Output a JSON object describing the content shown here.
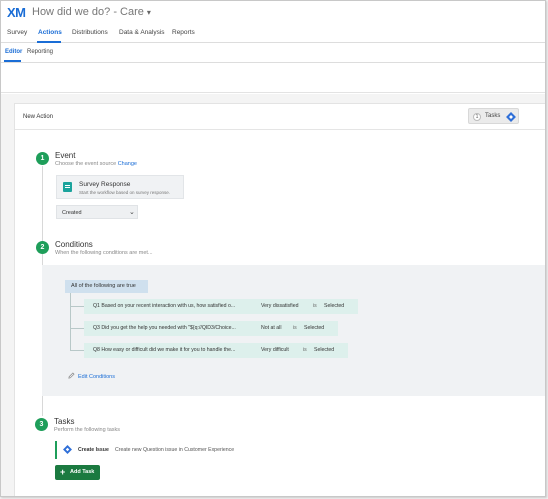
{
  "app": {
    "logo": "XM",
    "project_title": "How did we do? - Care"
  },
  "nav": {
    "tabs": [
      "Survey",
      "Actions",
      "Distributions",
      "Data & Analysis",
      "Reports"
    ],
    "active": "Actions"
  },
  "subnav": {
    "tabs": [
      "Editor",
      "Reporting"
    ],
    "active": "Editor"
  },
  "action": {
    "title": "New Action",
    "tasks_count": "1",
    "tasks_label": "Tasks"
  },
  "event": {
    "number": "1",
    "title": "Event",
    "subtitle": "Choose the event source",
    "change_link": "Change",
    "source_title": "Survey Response",
    "source_desc": "Start the workflow based on survey response.",
    "select_value": "Created"
  },
  "conditions": {
    "number": "2",
    "title": "Conditions",
    "subtitle": "When the following conditions are met...",
    "group_label": "All of the following are true",
    "rows": [
      {
        "question": "Q1 Based on your recent interaction with us, how satisfied o...",
        "value": "Very dissatisfied",
        "op": "is",
        "state": "Selected"
      },
      {
        "question": "Q3 Did you get the help you needed with \"${q://QID3/Choice...",
        "value": "Not at all",
        "op": "is",
        "state": "Selected"
      },
      {
        "question": "Q8 How easy or difficult did we make it for you to handle the...",
        "value": "Very difficult",
        "op": "is",
        "state": "Selected"
      }
    ],
    "edit_label": "Edit Conditions"
  },
  "tasks": {
    "number": "3",
    "title": "Tasks",
    "subtitle": "Perform the following tasks",
    "items": [
      {
        "name": "Create Issue",
        "desc": "Create new Question issue in Customer Experience"
      }
    ],
    "add_label": "Add Task"
  },
  "colors": {
    "brand": "#1a6dd6",
    "step": "#1e9e5a",
    "add_button": "#1b7a40"
  }
}
